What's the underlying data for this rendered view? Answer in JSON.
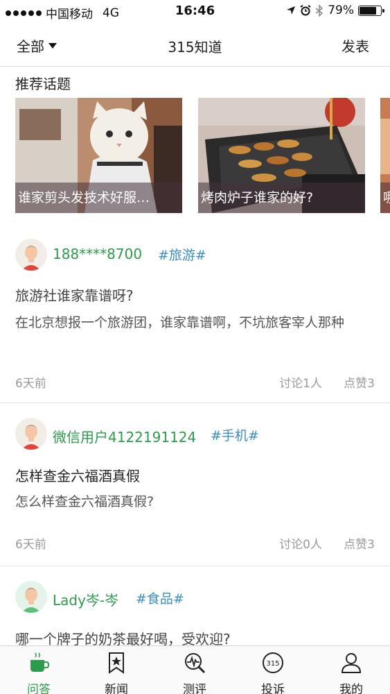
{
  "status_bar": {
    "carrier": "中国移动",
    "network": "4G",
    "time": "16:46",
    "battery_text": "79%",
    "battery_level": 0.79
  },
  "nav": {
    "left_label": "全部",
    "title": "315知道",
    "right_label": "发表"
  },
  "topics": {
    "title": "推荐话题",
    "items": [
      {
        "caption": "谁家剪头发技术好服…"
      },
      {
        "caption": "烤肉炉子谁家的好?"
      },
      {
        "caption": "哪"
      }
    ]
  },
  "posts": [
    {
      "username": "188****8700",
      "tag": "#旅游#",
      "title": "旅游社谁家靠谱呀?",
      "body": "在北京想报一个旅游团，谁家靠谱啊，不坑旅客宰人那种",
      "time": "6天前",
      "discuss": "讨论1人",
      "likes": "点赞3"
    },
    {
      "username": "微信用户4122191124",
      "tag": "#手机#",
      "title": "怎样查金六福酒真假",
      "body": "怎么样查金六福酒真假?",
      "time": "6天前",
      "discuss": "讨论0人",
      "likes": "点赞3"
    },
    {
      "username": "Lady岑-岑",
      "tag": "#食品#",
      "title": "哪一个牌子的奶茶最好喝，受欢迎?"
    }
  ],
  "tabs": [
    {
      "label": "问答",
      "icon": "coffee-cup-icon",
      "active": true
    },
    {
      "label": "新闻",
      "icon": "bookmark-star-icon",
      "active": false
    },
    {
      "label": "测评",
      "icon": "pulse-magnifier-icon",
      "active": false
    },
    {
      "label": "投诉",
      "icon": "315-badge-icon",
      "active": false
    },
    {
      "label": "我的",
      "icon": "person-icon",
      "active": false
    }
  ],
  "colors": {
    "accent_green": "#2d9a4e",
    "tag_blue": "#3b8fc0",
    "meta_gray": "#9a9a9a"
  }
}
